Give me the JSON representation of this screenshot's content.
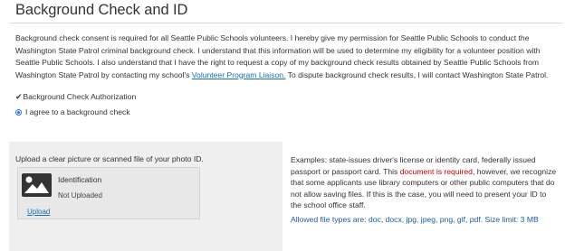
{
  "section": {
    "title": "Background Check and ID"
  },
  "consent": {
    "text_before_link": "Background check consent is required for all Seattle Public Schools volunteers. I hereby give my permission for Seattle Public Schools to conduct the Washington State Patrol criminal background check. I understand that this information will be used to determine my eligibility for a volunteer position with Seattle Public Schools. I also understand that I have the right to request a copy of my background check results obtained by Seattle Public Schools from Washington State Patrol by contacting my school's ",
    "link_text": "Volunteer Program Liaison.",
    "text_after_link": " To dispute background check results, I will contact Washington State Patrol.",
    "auth_check_glyph": "✔",
    "auth_label": "Background Check Authorization",
    "agree_label": "I agree to a background check",
    "agree_selected": true
  },
  "upload": {
    "prompt": "Upload a clear picture or scanned file of your photo ID.",
    "id_icon": "image-placeholder-icon",
    "id_name": "Identification",
    "id_status": "Not Uploaded",
    "upload_link": "Upload"
  },
  "examples": {
    "text_before": "Examples: state-issues driver's license or identity card, federally issued passport or passport card. This ",
    "required_text": "document is required",
    "text_after": ", however, we recognize that some applicants use library computers or other public computers that do not allow saving files. If this is the case, you will need to present your ID to the school office staff.",
    "allowed_types": "Allowed file types are: doc, docx, jpg, jpeg, png, gif, pdf. Size limit: 3 MB"
  },
  "colors": {
    "link": "#1a6fb5",
    "required": "#cc0000",
    "allowed_types": "#1a5a9e",
    "panel_bg": "#efefef"
  }
}
